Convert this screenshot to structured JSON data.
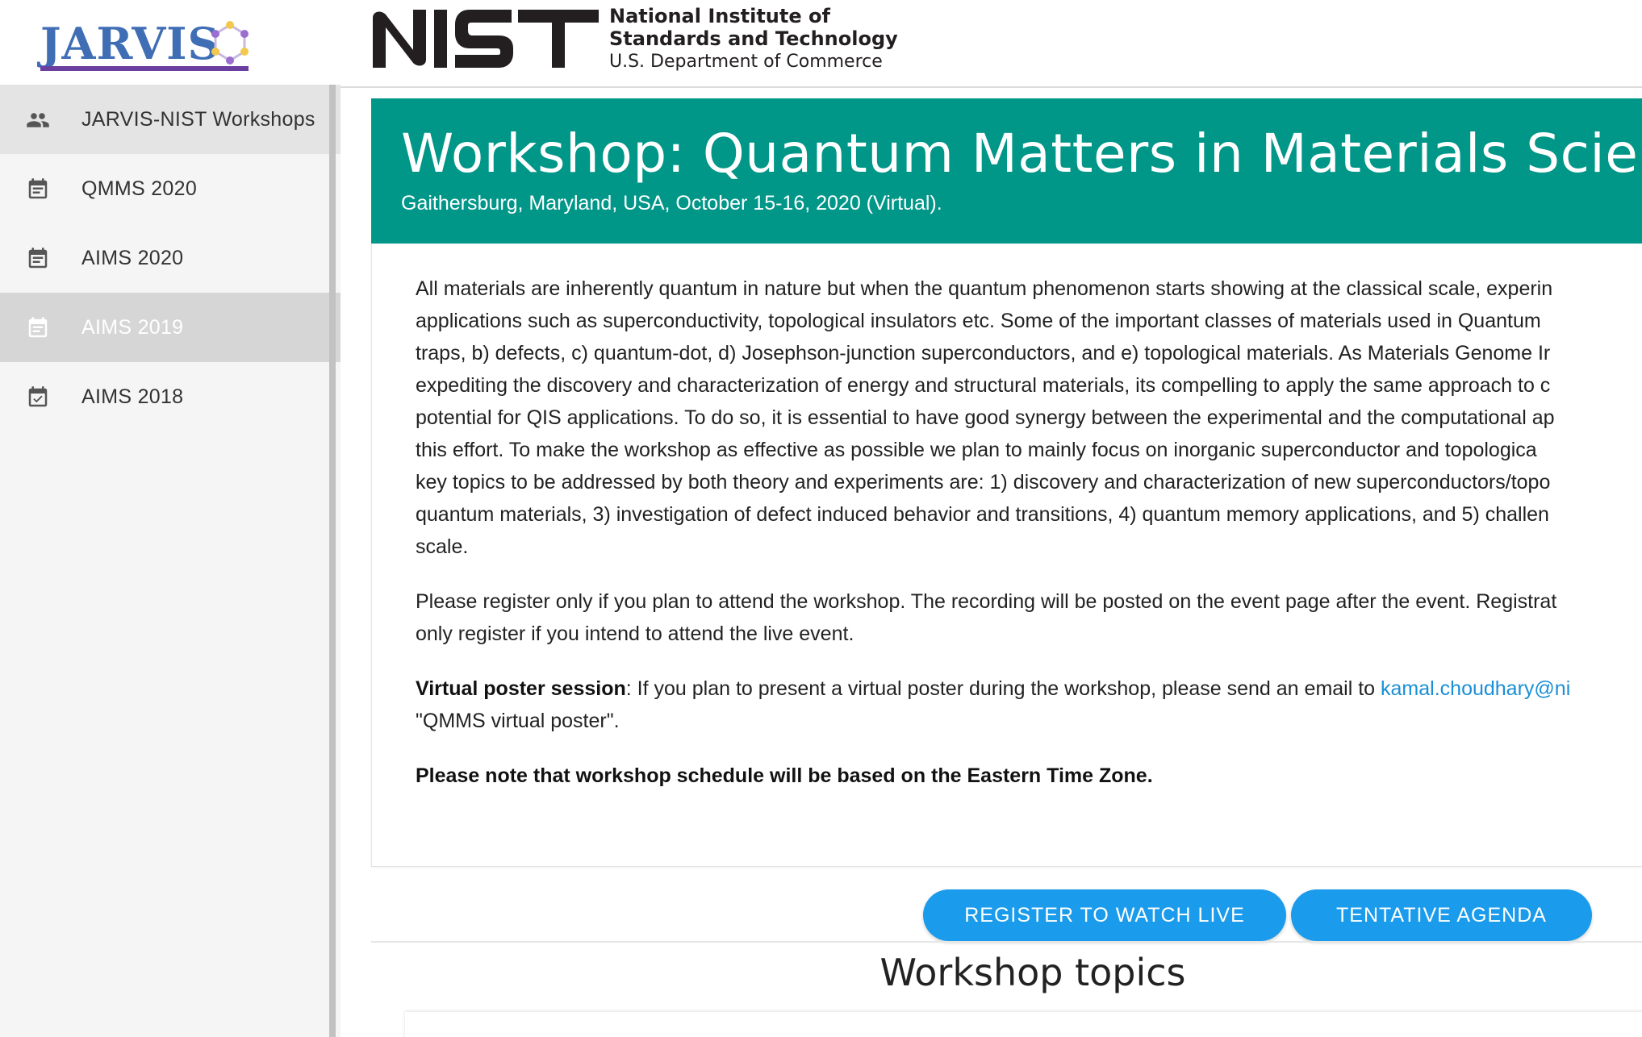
{
  "brand": {
    "logo_text": "JARVIS",
    "logo_color": "#3f6eb5",
    "underline_color": "#6b3fa0"
  },
  "sidebar": {
    "items": [
      {
        "label": "JARVIS-NIST Workshops",
        "icon": "people-icon"
      },
      {
        "label": "QMMS 2020",
        "icon": "calendar-note-icon"
      },
      {
        "label": "AIMS 2020",
        "icon": "calendar-note-icon"
      },
      {
        "label": "AIMS 2019",
        "icon": "calendar-note-icon"
      },
      {
        "label": "AIMS 2018",
        "icon": "calendar-check-icon"
      }
    ]
  },
  "header": {
    "nist_mark": "NIST",
    "nist_line1": "National Institute of",
    "nist_line2": "Standards and Technology",
    "nist_line3": "U.S. Department of Commerce"
  },
  "banner": {
    "title": "Workshop: Quantum Matters in Materials Science",
    "subtitle": "Gaithersburg, Maryland, USA, October 15-16, 2020 (Virtual).",
    "color": "#009688"
  },
  "content": {
    "intro_lines": [
      "All materials are inherently quantum in nature but when the quantum phenomenon starts showing at the classical scale, experin",
      "applications such as superconductivity, topological insulators etc. Some of the important classes of materials used in Quantum",
      "traps, b) defects, c) quantum-dot, d) Josephson-junction superconductors, and e) topological materials. As Materials Genome Ir",
      "expediting the discovery and characterization of energy and structural materials, its compelling to apply the same approach to c",
      "potential for QIS applications. To do so, it is essential to have good synergy between the experimental and the computational ap",
      "this effort. To make the workshop as effective as possible we plan to mainly focus on inorganic superconductor and topologica",
      "key topics to be addressed by both theory and experiments are: 1) discovery and characterization of new superconductors/topo",
      "quantum materials, 3) investigation of defect induced behavior and transitions, 4) quantum memory applications, and 5) challen",
      "scale."
    ],
    "register_lines": [
      "Please register only if you plan to attend the workshop. The recording will be posted on the event page after the event. Registrat",
      "only register if you intend to attend the live event."
    ],
    "poster_bold": "Virtual poster session",
    "poster_text": ": If you plan to present a virtual poster during the workshop, please send an email to ",
    "poster_email": "kamal.choudhary@ni",
    "poster_line2": "\"QMMS virtual poster\".",
    "timezone_note": "Please note that workshop schedule will be based on the Eastern Time Zone."
  },
  "buttons": {
    "register_label": "REGISTER TO WATCH LIVE",
    "agenda_label": "TENTATIVE AGENDA",
    "color": "#1a9bec"
  },
  "section": {
    "topics_title": "Workshop topics"
  }
}
